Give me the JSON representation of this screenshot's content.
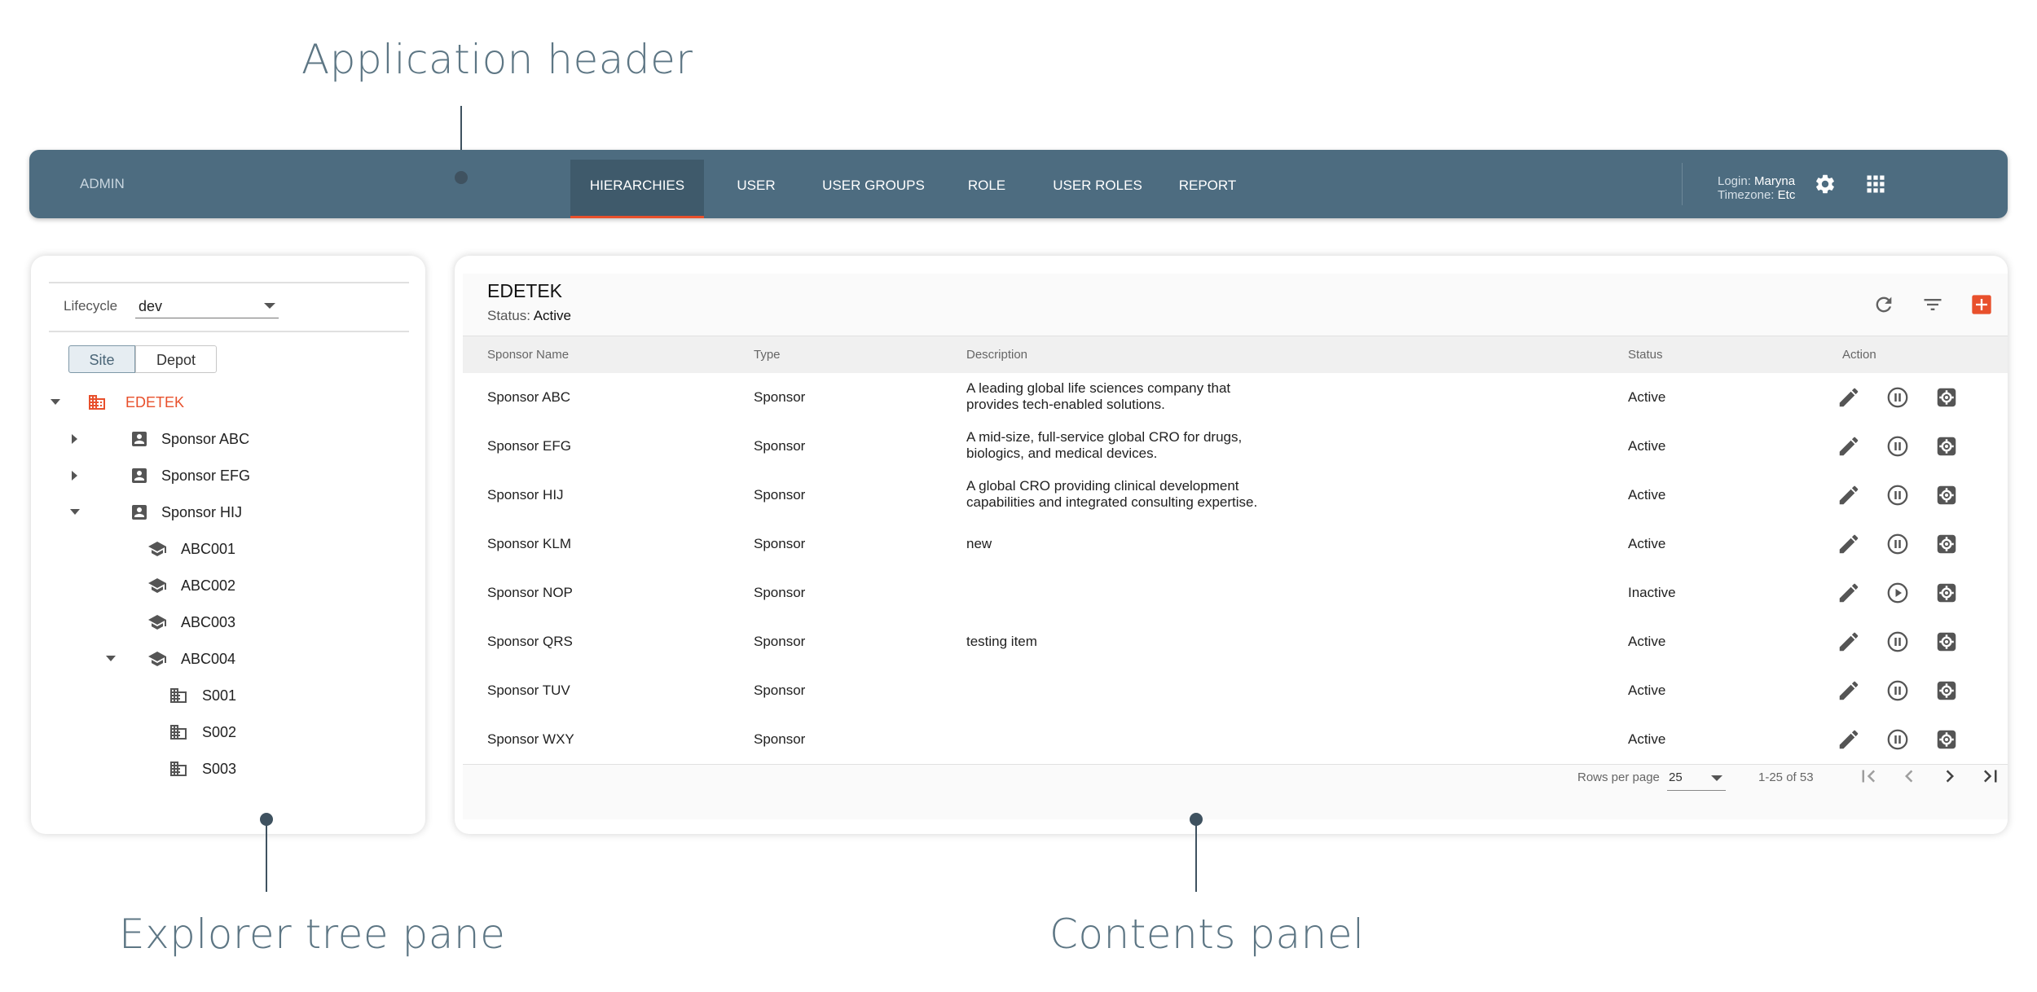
{
  "callouts": {
    "application_header": "Application header",
    "explorer_tree_pane": "Explorer tree pane",
    "contents_panel": "Contents panel"
  },
  "header": {
    "admin_label": "ADMIN",
    "tabs": [
      {
        "label": "HIERARCHIES",
        "active": true
      },
      {
        "label": "USER",
        "active": false
      },
      {
        "label": "USER GROUPS",
        "active": false
      },
      {
        "label": "ROLE",
        "active": false
      },
      {
        "label": "USER ROLES",
        "active": false
      },
      {
        "label": "REPORT",
        "active": false
      }
    ],
    "login_label": "Login:",
    "login_value": "Maryna",
    "timezone_label": "Timezone:",
    "timezone_value": "Etc",
    "icons": [
      "gear-icon",
      "apps-grid-icon"
    ]
  },
  "tree": {
    "lifecycle_label": "Lifecycle",
    "lifecycle_value": "dev",
    "toggle": {
      "site": "Site",
      "depot": "Depot",
      "selected": "Site"
    },
    "nodes": [
      {
        "label": "EDETEK",
        "icon": "building-icon",
        "expanded": true
      },
      {
        "label": "Sponsor ABC",
        "icon": "person-badge-icon",
        "expanded": false
      },
      {
        "label": "Sponsor EFG",
        "icon": "person-badge-icon",
        "expanded": false
      },
      {
        "label": "Sponsor HIJ",
        "icon": "person-badge-icon",
        "expanded": true
      },
      {
        "label": "ABC001",
        "icon": "graduation-cap-icon"
      },
      {
        "label": "ABC002",
        "icon": "graduation-cap-icon"
      },
      {
        "label": "ABC003",
        "icon": "graduation-cap-icon"
      },
      {
        "label": "ABC004",
        "icon": "graduation-cap-icon",
        "expanded": true
      },
      {
        "label": "S001",
        "icon": "site-building-icon"
      },
      {
        "label": "S002",
        "icon": "site-building-icon"
      },
      {
        "label": "S003",
        "icon": "site-building-icon"
      }
    ]
  },
  "contents": {
    "title": "EDETEK",
    "status_label": "Status:",
    "status_value": "Active",
    "columns": [
      "Sponsor Name",
      "Type",
      "Description",
      "Status",
      "Action"
    ],
    "rows": [
      {
        "name": "Sponsor ABC",
        "type": "Sponsor",
        "desc1": "A leading global life sciences company that",
        "desc2": "provides tech-enabled solutions.",
        "status": "Active",
        "toggle": "pause"
      },
      {
        "name": "Sponsor EFG",
        "type": "Sponsor",
        "desc1": "A mid-size, full-service global CRO for drugs,",
        "desc2": "biologics, and medical devices.",
        "status": "Active",
        "toggle": "pause"
      },
      {
        "name": "Sponsor HIJ",
        "type": "Sponsor",
        "desc1": "A global CRO providing clinical development",
        "desc2": "capabilities and integrated consulting expertise.",
        "status": "Active",
        "toggle": "pause"
      },
      {
        "name": "Sponsor KLM",
        "type": "Sponsor",
        "desc1": "new",
        "desc2": "",
        "status": "Active",
        "toggle": "pause"
      },
      {
        "name": "Sponsor NOP",
        "type": "Sponsor",
        "desc1": "",
        "desc2": "",
        "status": "Inactive",
        "toggle": "play"
      },
      {
        "name": "Sponsor QRS",
        "type": "Sponsor",
        "desc1": "testing item",
        "desc2": "",
        "status": "Active",
        "toggle": "pause"
      },
      {
        "name": "Sponsor TUV",
        "type": "Sponsor",
        "desc1": "",
        "desc2": "",
        "status": "Active",
        "toggle": "pause"
      },
      {
        "name": "Sponsor WXY",
        "type": "Sponsor",
        "desc1": "",
        "desc2": "",
        "status": "Active",
        "toggle": "pause"
      }
    ],
    "pagination": {
      "rows_per_page_label": "Rows per page",
      "rows_per_page_value": "25",
      "range_label": "1-25 of 53"
    },
    "colors": {
      "accent": "#e8502c",
      "header": "#4d6c80"
    }
  }
}
